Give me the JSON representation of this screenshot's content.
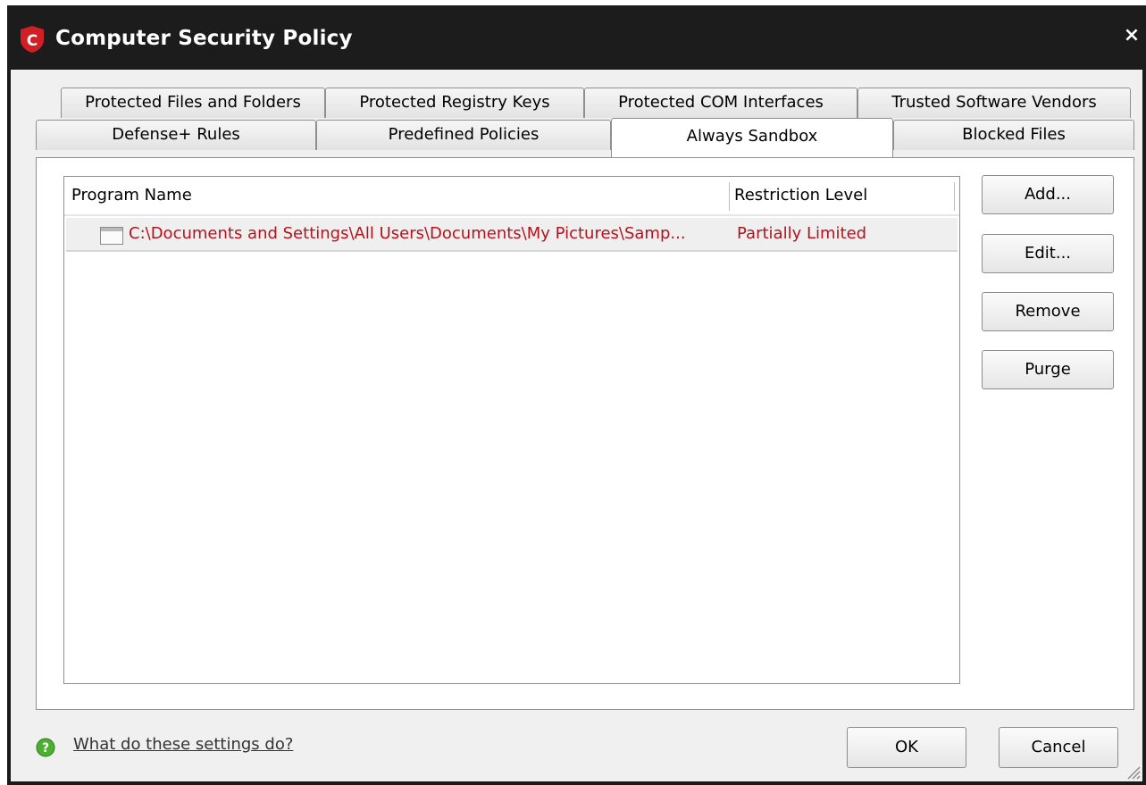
{
  "window": {
    "title": "Computer Security Policy",
    "close_glyph": "×",
    "logo_letter": "C",
    "logo_color": "#d21f26"
  },
  "tabs": {
    "row1": [
      {
        "label": "Protected Files and Folders"
      },
      {
        "label": "Protected Registry Keys"
      },
      {
        "label": "Protected COM Interfaces"
      },
      {
        "label": "Trusted Software Vendors"
      }
    ],
    "row2": [
      {
        "label": "Defense+ Rules"
      },
      {
        "label": "Predefined Policies"
      },
      {
        "label": "Always Sandbox",
        "active": true
      },
      {
        "label": "Blocked Files"
      }
    ]
  },
  "list": {
    "columns": [
      "Program Name",
      "Restriction Level"
    ],
    "rows": [
      {
        "program": "C:\\Documents and Settings\\All Users\\Documents\\My Pictures\\Samp...",
        "restriction": "Partially Limited",
        "icon": "application-window-icon",
        "text_color": "#b5121b"
      }
    ]
  },
  "side_buttons": {
    "add": "Add...",
    "edit": "Edit...",
    "remove": "Remove",
    "purge": "Purge"
  },
  "footer": {
    "help_text": "What do these settings do?",
    "help_icon": "question-mark-icon",
    "ok": "OK",
    "cancel": "Cancel"
  }
}
